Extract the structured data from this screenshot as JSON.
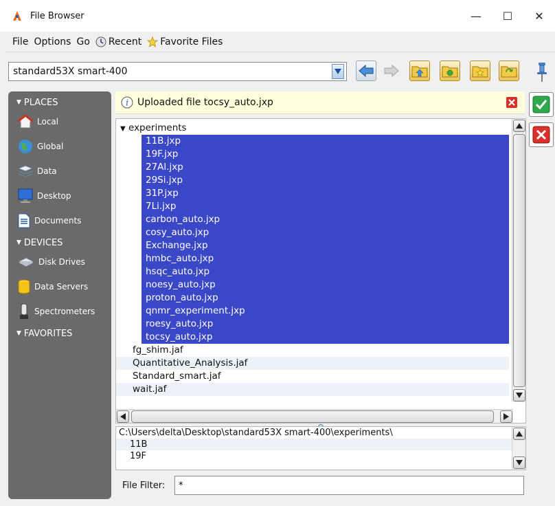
{
  "window": {
    "title": "File Browser",
    "minimize": "—",
    "maximize": "☐",
    "close": "✕"
  },
  "menu": {
    "file": "File",
    "options": "Options",
    "go": "Go",
    "recent": "Recent",
    "favorites": "Favorite Files"
  },
  "location": {
    "value": "standard53X smart-400"
  },
  "sidebar": {
    "places_header": "PLACES",
    "places": [
      "Local",
      "Global",
      "Data",
      "Desktop",
      "Documents"
    ],
    "devices_header": "DEVICES",
    "devices": [
      "Disk Drives",
      "Data Servers",
      "Spectrometers"
    ],
    "favorites_header": "FAVORITES"
  },
  "info": {
    "message": "Uploaded file tocsy_auto.jxp"
  },
  "tree": {
    "folder": "experiments",
    "selected_files": [
      "11B.jxp",
      "19F.jxp",
      "27Al.jxp",
      "29Si.jxp",
      "31P.jxp",
      "7Li.jxp",
      "carbon_auto.jxp",
      "cosy_auto.jxp",
      "Exchange.jxp",
      "hmbc_auto.jxp",
      "hsqc_auto.jxp",
      "noesy_auto.jxp",
      "proton_auto.jxp",
      "qnmr_experiment.jxp",
      "roesy_auto.jxp",
      "tocsy_auto.jxp"
    ],
    "files": [
      "fg_shim.jaf",
      "Quantitative_Analysis.jaf",
      "Standard_smart.jaf",
      "wait.jaf"
    ]
  },
  "path_panel": {
    "path": "C:\\Users\\delta\\Desktop\\standard53X smart-400\\experiments\\",
    "items": [
      "11B",
      "19F"
    ]
  },
  "filter": {
    "label": "File Filter:",
    "value": "*"
  },
  "colors": {
    "selection": "#3a47c6",
    "sidebar": "#6a6a6a",
    "info_bg": "#ffffdd",
    "ok": "#2ea84a",
    "cancel": "#d9302c"
  }
}
